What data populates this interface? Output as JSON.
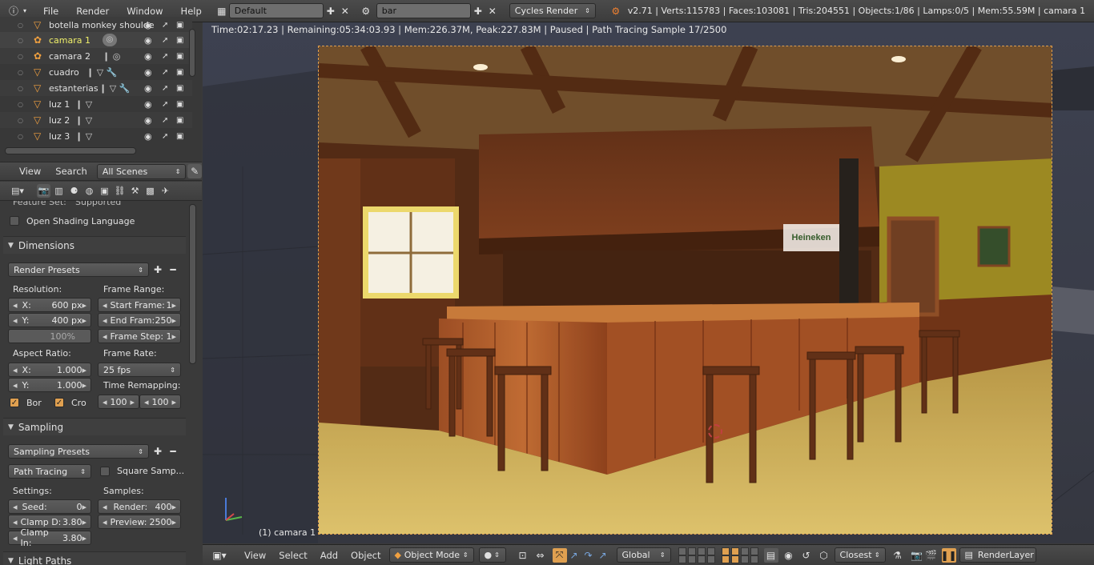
{
  "topbar": {
    "menus": [
      "File",
      "Render",
      "Window",
      "Help"
    ],
    "screen_layout": "Default",
    "scene": "bar",
    "render_engine": "Cycles Render",
    "stats": "v2.71 | Verts:115783 | Faces:103081 | Tris:204551 | Objects:1/86 | Lamps:0/5 | Mem:55.59M | camara 1"
  },
  "outliner": {
    "rows": [
      {
        "name": "botella monkey shoulde",
        "icon": "mesh-icon"
      },
      {
        "name": "camara 1",
        "icon": "camera-icon",
        "active": true
      },
      {
        "name": "camara 2",
        "icon": "camera-icon"
      },
      {
        "name": "cuadro",
        "icon": "mesh-icon"
      },
      {
        "name": "estanterias",
        "icon": "mesh-icon"
      },
      {
        "name": "luz 1",
        "icon": "mesh-icon"
      },
      {
        "name": "luz 2",
        "icon": "mesh-icon"
      },
      {
        "name": "luz 3",
        "icon": "mesh-icon"
      }
    ],
    "header": {
      "view": "View",
      "search": "Search",
      "scenes": "All Scenes"
    }
  },
  "properties": {
    "feature_set_label": "Feature Set:",
    "feature_set_value": "Supported",
    "osl_label": "Open Shading Language",
    "dimensions": {
      "title": "Dimensions",
      "presets": "Render Presets",
      "resolution_label": "Resolution:",
      "res_x_label": "X:",
      "res_x": "600 px",
      "res_y_label": "Y:",
      "res_y": "400 px",
      "res_pct": "100%",
      "frame_range_label": "Frame Range:",
      "start_label": "Start Frame:",
      "start": "1",
      "end_label": "End Fram:",
      "end": "250",
      "step_label": "Frame Step:",
      "step": "1",
      "aspect_label": "Aspect Ratio:",
      "asp_x_label": "X:",
      "asp_x": "1.000",
      "asp_y_label": "Y:",
      "asp_y": "1.000",
      "frame_rate_label": "Frame Rate:",
      "fps": "25 fps",
      "time_remap_label": "Time Remapping:",
      "remap_old": "100",
      "remap_new": "100",
      "border_label": "Bor",
      "crop_label": "Cro"
    },
    "sampling": {
      "title": "Sampling",
      "presets": "Sampling Presets",
      "integrator": "Path Tracing",
      "square_label": "Square Samp...",
      "settings_label": "Settings:",
      "samples_label": "Samples:",
      "seed_label": "Seed:",
      "seed": "0",
      "clamp_d_label": "Clamp D:",
      "clamp_d": "3.80",
      "clamp_i_label": "Clamp In:",
      "clamp_i": "3.80",
      "render_label": "Render:",
      "render": "400",
      "preview_label": "Preview:",
      "preview": "2500"
    },
    "light_paths_title": "Light Paths"
  },
  "viewport": {
    "info": "Time:02:17.23 | Remaining:05:34:03.93 | Mem:226.37M, Peak:227.83M | Paused | Path Tracing Sample 17/2500",
    "camera_label": "(1) camara 1",
    "sign_text": "Heineken"
  },
  "bottombar": {
    "view": "View",
    "select": "Select",
    "add": "Add",
    "object": "Object",
    "mode": "Object Mode",
    "orientation": "Global",
    "snap": "Closest",
    "render_layer": "RenderLayer"
  },
  "colors": {
    "accent": "#e0a050",
    "active_text": "#f0f06a"
  }
}
